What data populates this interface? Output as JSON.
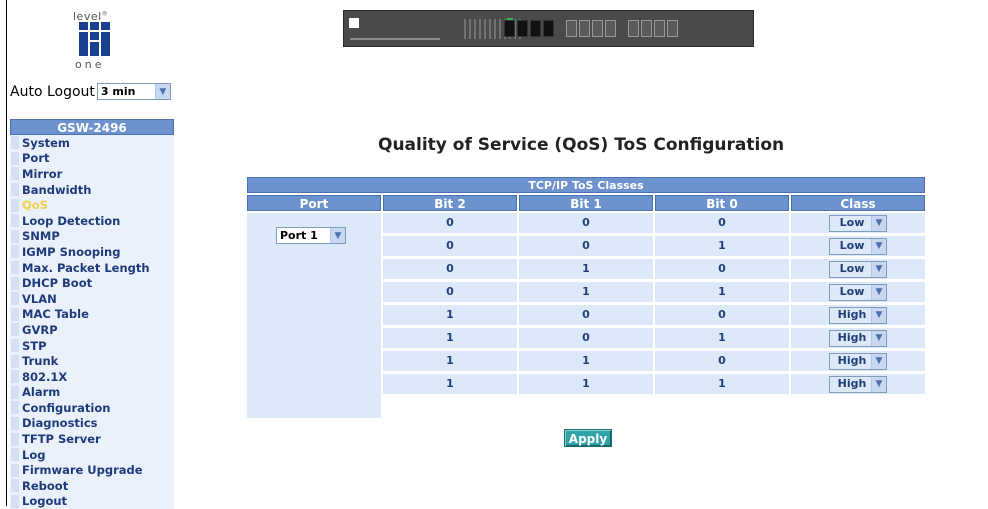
{
  "logo": {
    "top_text": "level",
    "trademark": "®",
    "bottom_text": "one"
  },
  "auto_logout": {
    "label": "Auto Logout",
    "value": "3 min"
  },
  "sidebar": {
    "device_name": "GSW-2496",
    "items": [
      {
        "label": "System"
      },
      {
        "label": "Port"
      },
      {
        "label": "Mirror"
      },
      {
        "label": "Bandwidth"
      },
      {
        "label": "QoS",
        "active": true
      },
      {
        "label": "Loop Detection"
      },
      {
        "label": "SNMP"
      },
      {
        "label": "IGMP Snooping"
      },
      {
        "label": "Max. Packet Length"
      },
      {
        "label": "DHCP Boot"
      },
      {
        "label": "VLAN"
      },
      {
        "label": "MAC Table"
      },
      {
        "label": "GVRP"
      },
      {
        "label": "STP"
      },
      {
        "label": "Trunk"
      },
      {
        "label": "802.1X"
      },
      {
        "label": "Alarm"
      },
      {
        "label": "Configuration"
      },
      {
        "label": "Diagnostics"
      },
      {
        "label": "TFTP Server"
      },
      {
        "label": "Log"
      },
      {
        "label": "Firmware Upgrade"
      },
      {
        "label": "Reboot"
      },
      {
        "label": "Logout"
      }
    ]
  },
  "main": {
    "title": "Quality of Service (QoS) ToS Configuration",
    "table": {
      "caption": "TCP/IP ToS Classes",
      "headers": [
        "Port",
        "Bit 2",
        "Bit 1",
        "Bit 0",
        "Class"
      ],
      "port_select": "Port 1",
      "rows": [
        {
          "bit2": "0",
          "bit1": "0",
          "bit0": "0",
          "class": "Low"
        },
        {
          "bit2": "0",
          "bit1": "0",
          "bit0": "1",
          "class": "Low"
        },
        {
          "bit2": "0",
          "bit1": "1",
          "bit0": "0",
          "class": "Low"
        },
        {
          "bit2": "0",
          "bit1": "1",
          "bit0": "1",
          "class": "Low"
        },
        {
          "bit2": "1",
          "bit1": "0",
          "bit0": "0",
          "class": "High"
        },
        {
          "bit2": "1",
          "bit1": "0",
          "bit0": "1",
          "class": "High"
        },
        {
          "bit2": "1",
          "bit1": "1",
          "bit0": "0",
          "class": "High"
        },
        {
          "bit2": "1",
          "bit1": "1",
          "bit0": "1",
          "class": "High"
        }
      ]
    },
    "apply_label": "Apply"
  },
  "icons": {
    "dropdown": "chevron-down-icon",
    "logo": "levelone-logo-icon",
    "device": "switch-device-image"
  },
  "colors": {
    "header_blue": "#6c93cd",
    "cell_bg": "#dde8f8",
    "active_item": "#f2cf4c",
    "apply_button": "#2ea4a8"
  }
}
